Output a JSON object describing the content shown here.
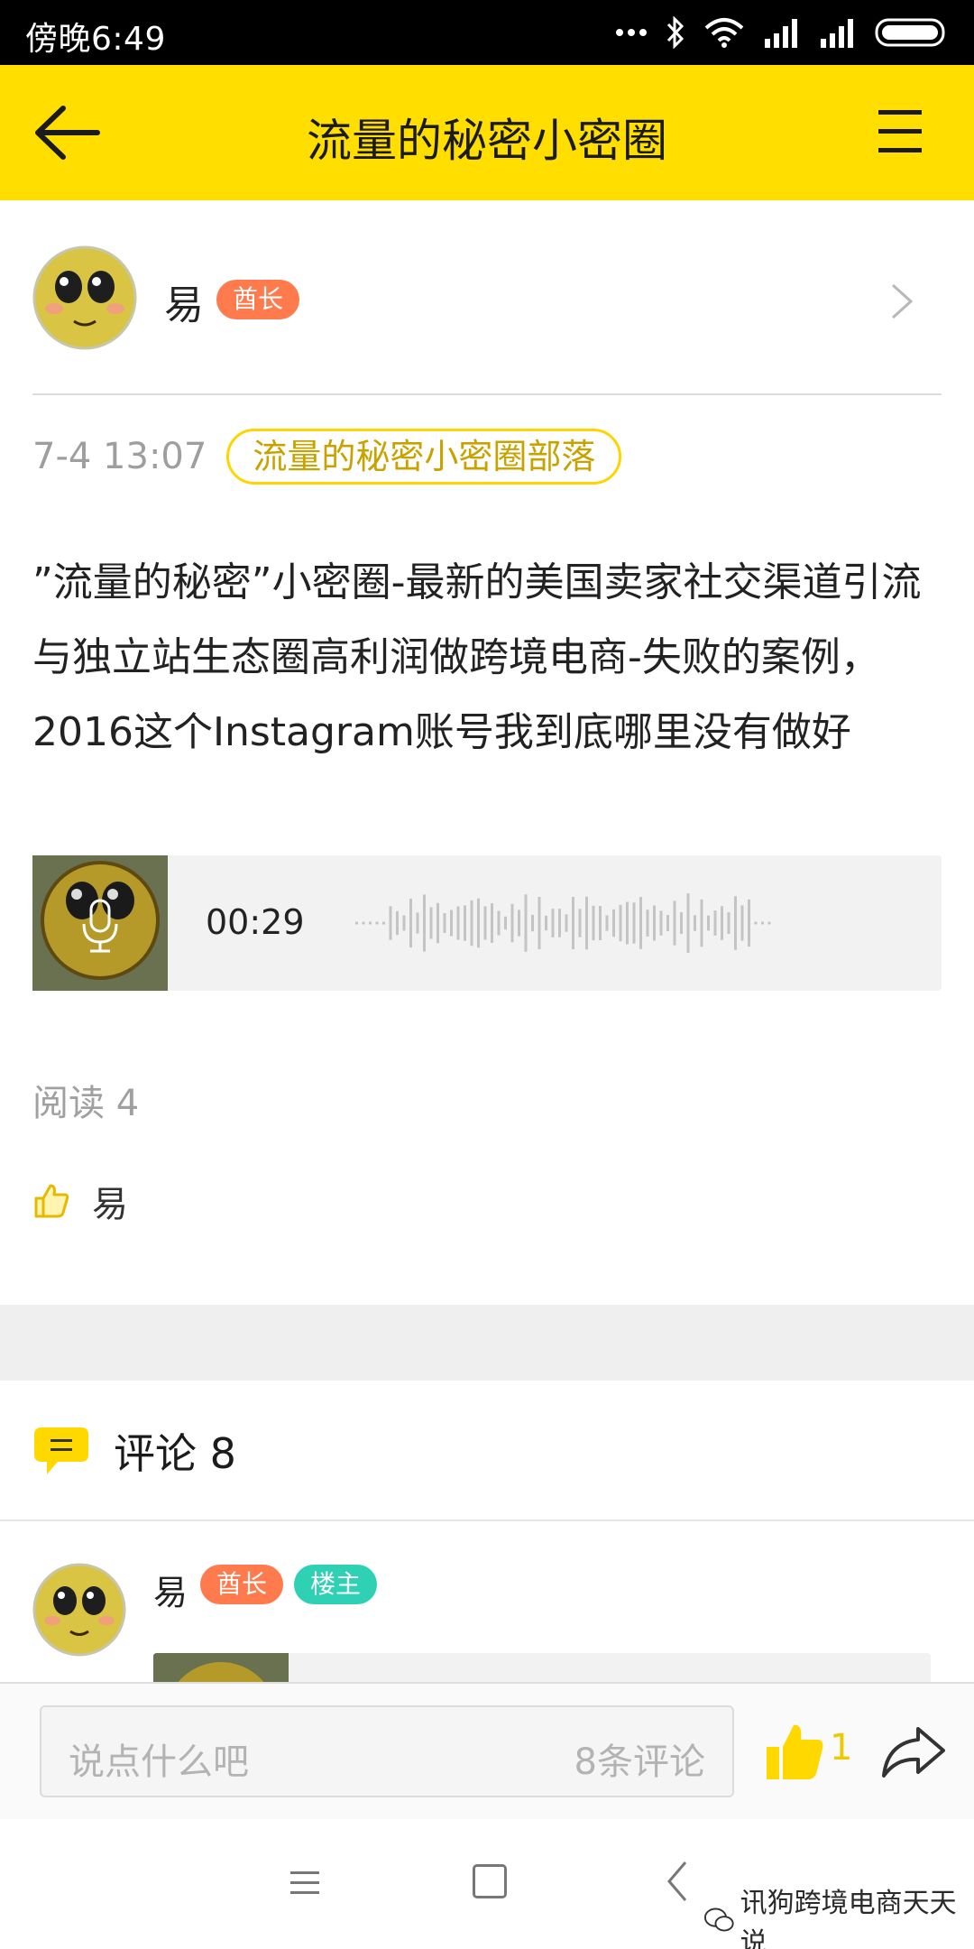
{
  "status_bar": {
    "time": "傍晚6:49",
    "icons": [
      "more-dots-icon",
      "bluetooth-icon",
      "wifi-icon",
      "signal-icon",
      "signal-icon",
      "battery-icon"
    ]
  },
  "app_bar": {
    "title": "流量的秘密小密圈",
    "back_icon": "arrow-left-icon",
    "menu_icon": "hamburger-menu-icon",
    "background": "#ffde00"
  },
  "post": {
    "author": {
      "name": "易",
      "badge": "酋长"
    },
    "time": "7-4 13:07",
    "tribe": "流量的秘密小密圈部落",
    "body": "”流量的秘密”小密圈-最新的美国卖家社交渠道引流与独立站生态圈高利润做跨境电商-失败的案例，2016这个Instagram账号我到底哪里没有做好",
    "audio": {
      "duration": "00:29",
      "icon": "microphone-icon"
    },
    "read_count": "阅读 4",
    "likes": {
      "icon": "thumbs-up-outline-icon",
      "users": "易"
    }
  },
  "comments": {
    "title": "评论 8",
    "icon": "comment-bubble-icon",
    "items": [
      {
        "name": "易",
        "badges": [
          "酋长",
          "楼主"
        ]
      }
    ]
  },
  "input_bar": {
    "placeholder": "说点什么吧",
    "count": "8条评论",
    "like_count": "1",
    "like_icon": "thumbs-up-filled-icon",
    "share_icon": "share-arrow-icon"
  },
  "nav_bar": {
    "icons": [
      "menu-lines-icon",
      "home-square-icon",
      "back-chevron-icon"
    ]
  },
  "watermark": {
    "text": "讯狗跨境电商天天说"
  },
  "colors": {
    "accent": "#ffde00",
    "chief_badge": "#ff7a4d",
    "owner_badge": "#2fd1b4"
  }
}
